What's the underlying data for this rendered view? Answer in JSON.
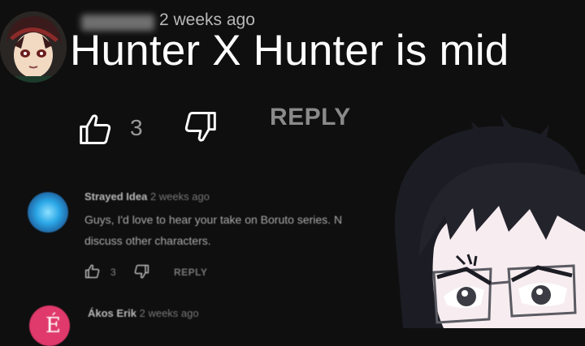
{
  "main_comment": {
    "author": "",
    "timestamp": "2 weeks ago",
    "text": "Hunter X Hunter is mid",
    "like_count": "3",
    "reply_label": "REPLY"
  },
  "replies": [
    {
      "author": "Strayed Idea",
      "timestamp": "2 weeks ago",
      "line1": "Guys, I'd love to hear your take on Boruto series. N",
      "line2": "discuss other characters.",
      "like_count": "3",
      "reply_label": "REPLY"
    },
    {
      "author": "Ákos Erik",
      "timestamp": "2 weeks ago",
      "avatar_letter": "É"
    }
  ],
  "colors": {
    "background": "#0f0f0f",
    "text_primary": "#ffffff",
    "text_secondary": "#aaaaaa",
    "reply_avatar_2": "#e0396b"
  },
  "icons": {
    "like": "thumbs-up-icon",
    "dislike": "thumbs-down-icon"
  }
}
